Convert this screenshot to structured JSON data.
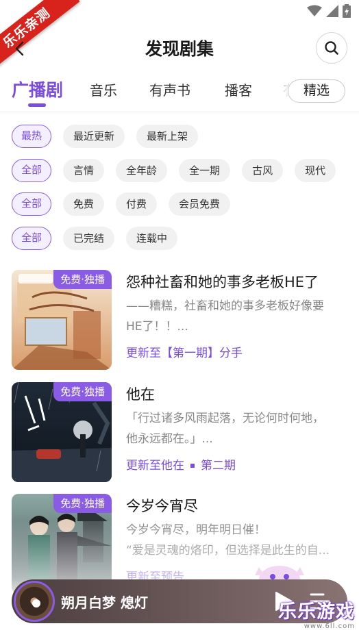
{
  "ribbon": {
    "text": "乐乐亲测"
  },
  "header": {
    "title": "发现剧集"
  },
  "tabs": [
    {
      "label": "广播剧",
      "active": true
    },
    {
      "label": "音乐"
    },
    {
      "label": "有声书"
    },
    {
      "label": "播客"
    },
    {
      "label": "有"
    }
  ],
  "filter_button": {
    "label": "精选"
  },
  "filters": {
    "sort": [
      "最热",
      "最近更新",
      "最新上架"
    ],
    "genre": [
      "全部",
      "言情",
      "全年龄",
      "全一期",
      "古风",
      "现代"
    ],
    "price": [
      "全部",
      "免费",
      "付费",
      "会员免费"
    ],
    "status": [
      "全部",
      "已完结",
      "连载中"
    ]
  },
  "items": [
    {
      "badge": "免费·独播",
      "title": "怨种社畜和她的事多老板HE了",
      "desc_lines": [
        "——糟糕，社畜和她的事多老板好像要",
        "HE了！！..."
      ],
      "update": "更新至【第一期】分手",
      "update_extra": ""
    },
    {
      "badge": "免费·独播",
      "title": "他在",
      "desc_lines": [
        "「行过诸多风雨起落，无论何时何地，",
        "他永远都在。」..."
      ],
      "update": "更新至他在",
      "update_extra": "第二期"
    },
    {
      "badge": "免费·独播",
      "title": "今岁今宵尽",
      "desc_lines": [
        "今岁今宵尽，明年明日催！",
        "“爱是灵魂的烙印，但选择是此生的自..."
      ],
      "update": "更新至预告",
      "update_extra": ""
    }
  ],
  "player": {
    "title": "朔月白梦 熄灯"
  },
  "watermark": {
    "main": "乐乐游戏",
    "sub": "www.6ll.com"
  },
  "colors": {
    "accent": "#7b4ce0",
    "badge": "#8a5ce6",
    "ribbon": "#d8221c"
  }
}
